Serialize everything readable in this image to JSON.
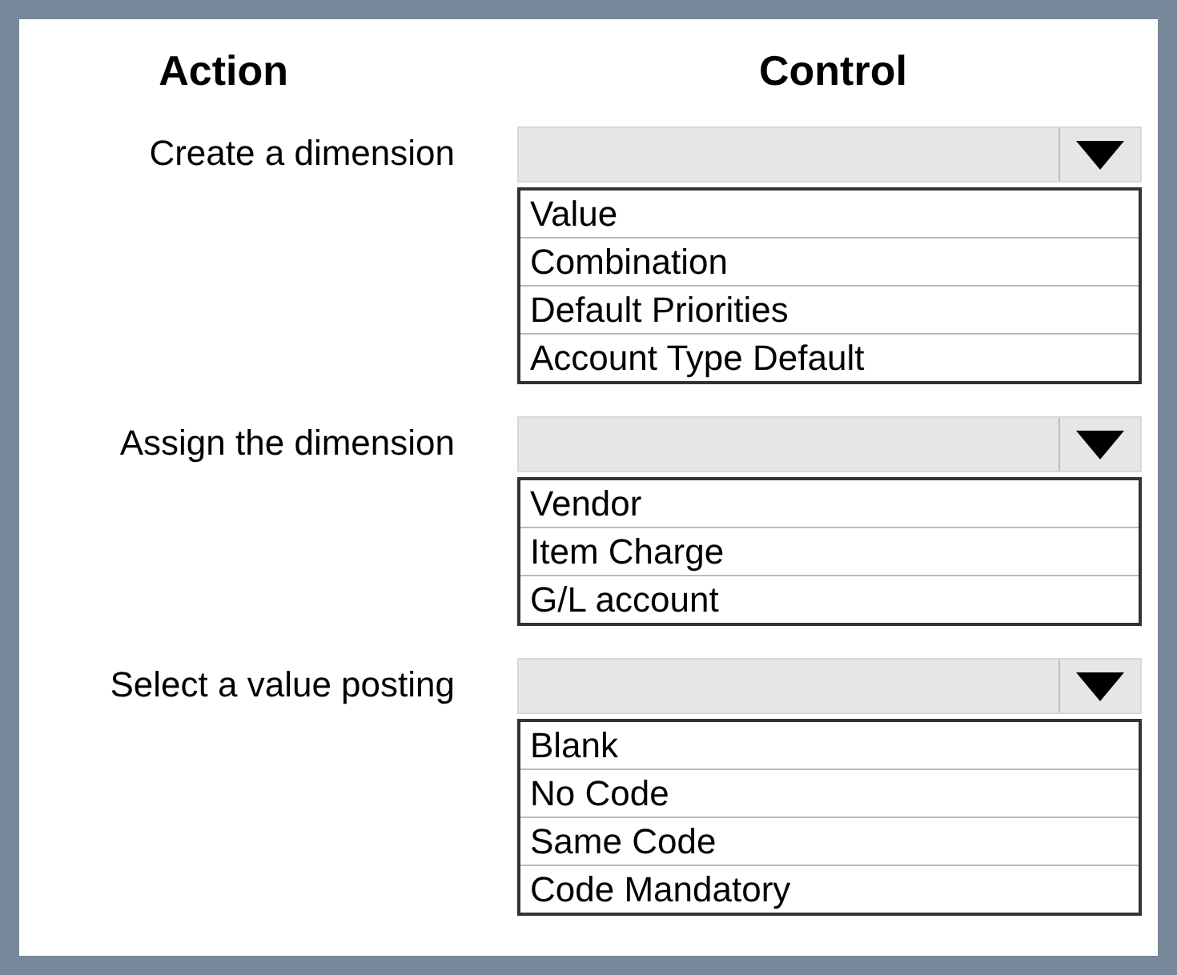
{
  "headers": {
    "action": "Action",
    "control": "Control"
  },
  "rows": [
    {
      "action": "Create a dimension",
      "options": [
        "Value",
        "Combination",
        "Default Priorities",
        "Account Type Default"
      ]
    },
    {
      "action": "Assign the dimension",
      "options": [
        "Vendor",
        "Item Charge",
        "G/L account"
      ]
    },
    {
      "action": "Select a value posting",
      "options": [
        "Blank",
        "No Code",
        "Same Code",
        "Code Mandatory"
      ]
    }
  ]
}
